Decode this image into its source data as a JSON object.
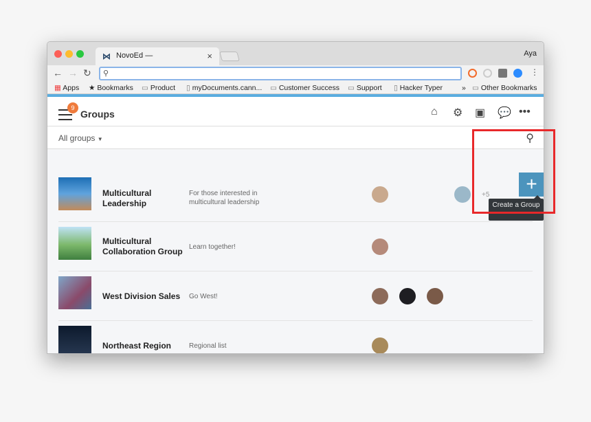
{
  "browser": {
    "tab_title": "NovoEd —",
    "user": "Aya",
    "bookmarks": [
      "Apps",
      "Bookmarks",
      "Product",
      "myDocuments.cann...",
      "Customer Success",
      "Support",
      "Hacker Typer",
      "»",
      "Other Bookmarks"
    ]
  },
  "header": {
    "notifications": "9",
    "title": "Groups"
  },
  "filter": {
    "selected": "All groups"
  },
  "create": {
    "tooltip": "Create a Group"
  },
  "groups": [
    {
      "name": "Multicultural Leadership",
      "description": "For those interested in multicultural leadership",
      "extra_members": "+5"
    },
    {
      "name": "Multicultural Collaboration Group",
      "description": "Learn together!"
    },
    {
      "name": "West Division Sales",
      "description": "Go West!"
    },
    {
      "name": "Northeast Region",
      "description": "Regional list"
    }
  ],
  "colors": {
    "accent": "#5aade0",
    "create_button": "#4c94bd",
    "badge": "#ef7b3c",
    "highlight": "#e8282a"
  }
}
